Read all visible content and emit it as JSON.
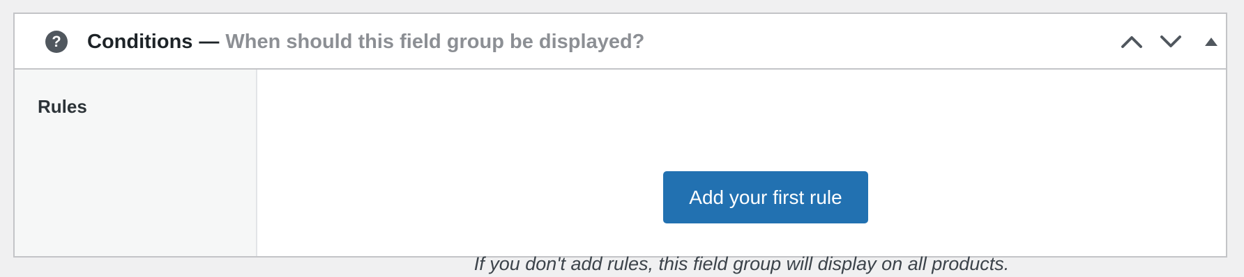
{
  "panel": {
    "help_icon": "question-mark-circle-icon",
    "help_glyph": "?",
    "title": "Conditions",
    "dash": "—",
    "subtitle": "When should this field group be displayed?",
    "controls": {
      "move_up_icon": "chevron-up-icon",
      "move_down_icon": "chevron-down-icon",
      "toggle_icon": "triangle-up-icon"
    }
  },
  "rules": {
    "label": "Rules",
    "add_button_label": "Add your first rule",
    "hint": "If you don't add rules, this field group will display on all products."
  },
  "colors": {
    "page_background": "#f0f0f1",
    "primary_button": "#2271b1",
    "subtitle": "#8c8f94",
    "label_column": "#f6f7f7"
  }
}
